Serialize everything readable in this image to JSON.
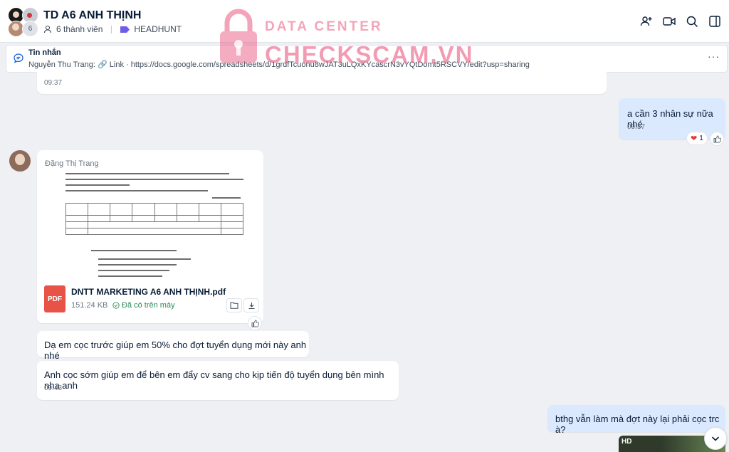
{
  "header": {
    "group_name": "TD A6 ANH THỊNH",
    "avatar_extra_count": "6",
    "members_label": "6 thành viên",
    "tag_label": "HEADHUNT",
    "tag_color": "#6c5ce7"
  },
  "pinned": {
    "title": "Tin nhắn",
    "text": "Nguyễn Thu Trang: 🔗 Link · https://docs.google.com/spreadsheets/d/1grdfTcuonu8wJAT3uLQxKYcascrN3vYQtDomt5RSCVY/edit?usp=sharing"
  },
  "watermark": {
    "line1": "DATA CENTER",
    "line2": "CHECKSCAM.VN"
  },
  "messages": {
    "m1": {
      "time": "09:37"
    },
    "m2": {
      "text": "a cần 3 nhân sự nữa nhé",
      "time": "09:37",
      "reaction_count": "1"
    },
    "m3": {
      "sender": "Đặng Thị Trang",
      "file_name": "DNTT MARKETING A6 ANH THỊNH.pdf",
      "file_type": "PDF",
      "file_size": "151.24 KB",
      "file_status": "Đã có trên máy"
    },
    "m4": {
      "text": "Dạ em cọc trước giúp em 50% cho đợt tuyển dụng mới này anh nhé"
    },
    "m5": {
      "text": "Anh cọc sớm giúp em để bên em đẩy cv sang cho kịp tiến độ tuyển dụng bên mình nha anh",
      "time": "09:43"
    },
    "m6": {
      "text": "bthg vẫn làm mà đợt này lại phải cọc trc à?"
    },
    "m7": {
      "badge": "HD"
    }
  },
  "colors": {
    "my_bubble": "#dbe9fe",
    "other_bubble": "#ffffff",
    "pdf_icon": "#e85347"
  }
}
